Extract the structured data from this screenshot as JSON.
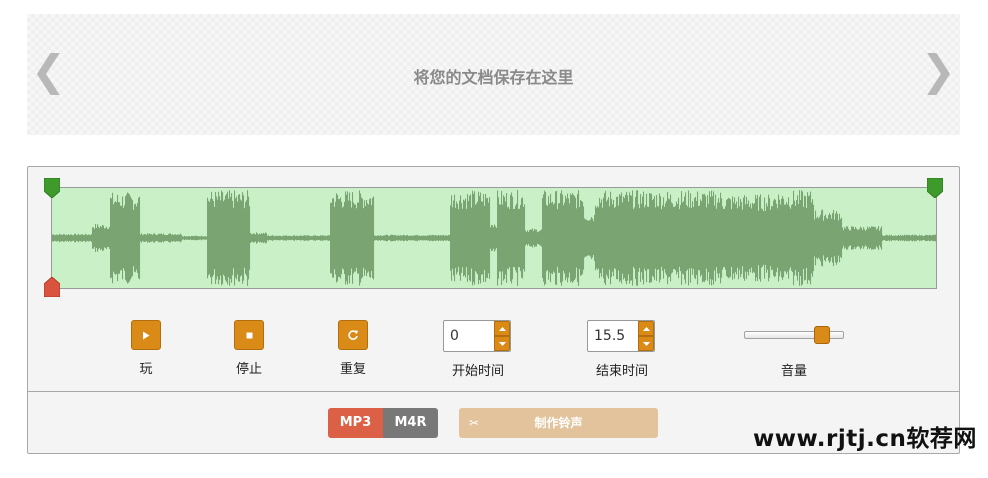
{
  "banner": {
    "title": "将您的文档保存在这里",
    "prev_glyph": "❮",
    "next_glyph": "❯",
    "prev_icon": "chevron-left-icon",
    "next_icon": "chevron-right-icon"
  },
  "editor": {
    "waveform": {
      "background_color": "#c9f0c6",
      "wave_color": "#7aa572",
      "start_marker_color": "#3e9b2b",
      "cursor_marker_color": "#d9533e"
    },
    "controls": {
      "play": {
        "label": "玩",
        "icon": "play-icon"
      },
      "stop": {
        "label": "停止",
        "icon": "stop-icon"
      },
      "repeat": {
        "label": "重复",
        "icon": "repeat-icon"
      },
      "start_time": {
        "label": "开始时间",
        "value": "0"
      },
      "end_time": {
        "label": "结束时间",
        "value": "15.5"
      },
      "volume": {
        "label": "音量",
        "level": 0.78
      }
    },
    "formats": [
      {
        "label": "MP3",
        "selected": true,
        "color": "#dc6046"
      },
      {
        "label": "M4R",
        "selected": false,
        "color": "#787878"
      }
    ],
    "make_button": {
      "label": "制作铃声",
      "icon": "scissors-icon",
      "glyph": "✂",
      "color": "#e2c39c"
    }
  },
  "watermark": {
    "text": "www.rjtj.cn软荐网"
  },
  "colors": {
    "accent": "#d98a17"
  }
}
